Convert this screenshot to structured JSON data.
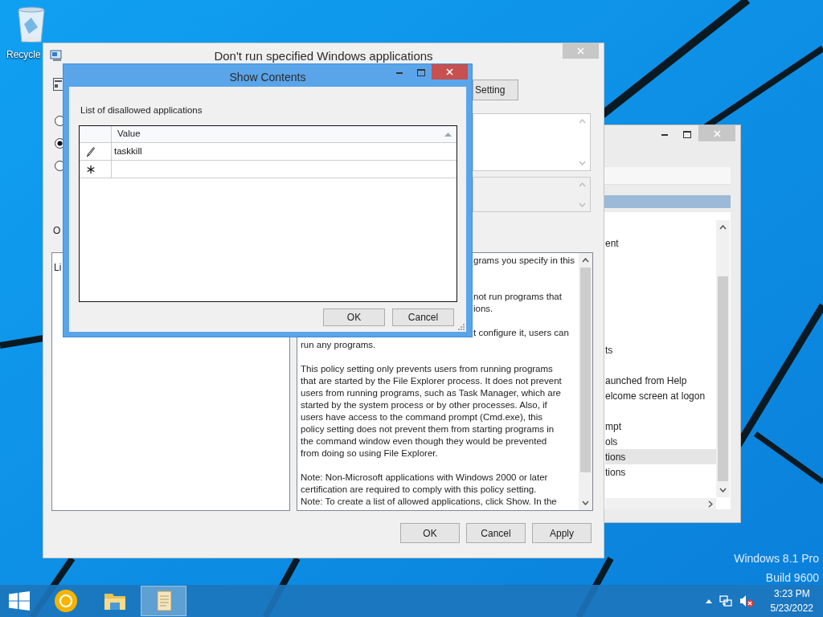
{
  "desktop": {
    "recycle_label": "Recycle",
    "edition": "Windows 8.1 Pro",
    "build": "Build 9600"
  },
  "back_window": {
    "rows": [
      {
        "kind": "covered",
        "selected": false
      },
      {
        "kind": "text",
        "text": "ent",
        "selected": false
      },
      {
        "kind": "covered",
        "selected": false
      },
      {
        "kind": "covered",
        "selected": false
      },
      {
        "kind": "covered",
        "selected": false
      },
      {
        "kind": "covered",
        "selected": false
      },
      {
        "kind": "covered",
        "selected": false
      },
      {
        "kind": "covered",
        "selected": false
      },
      {
        "kind": "text",
        "text": "ts",
        "selected": false
      },
      {
        "kind": "covered",
        "selected": false
      },
      {
        "kind": "text",
        "text": "aunched from Help",
        "selected": false
      },
      {
        "kind": "text",
        "text": "elcome screen at logon",
        "selected": false
      },
      {
        "kind": "covered",
        "selected": false
      },
      {
        "kind": "text",
        "text": "mpt",
        "selected": false
      },
      {
        "kind": "text",
        "text": "ols",
        "selected": false
      },
      {
        "kind": "text",
        "text": "tions",
        "selected": true
      },
      {
        "kind": "text",
        "text": "tions",
        "selected": false
      }
    ]
  },
  "main_window": {
    "title": "Don't run specified Windows applications",
    "setting_button": "Setting",
    "radios": [
      {
        "selected": false
      },
      {
        "selected": true
      },
      {
        "selected": false
      }
    ],
    "options_label": "O",
    "options_text": "Li",
    "help_lines": [
      {
        "kind": "partial",
        "text": "grams you specify in this"
      },
      {
        "kind": "gap"
      },
      {
        "kind": "gap"
      },
      {
        "kind": "partial",
        "text": "not run programs that"
      },
      {
        "kind": "partial",
        "text": "ions."
      },
      {
        "kind": "gap"
      },
      {
        "kind": "partial",
        "text": "t configure it, users can"
      },
      {
        "kind": "full",
        "text": "run any programs."
      },
      {
        "kind": "gap"
      },
      {
        "kind": "full",
        "text": "This policy setting only prevents users from running programs"
      },
      {
        "kind": "full",
        "text": "that are started by the File Explorer process. It does not prevent"
      },
      {
        "kind": "full",
        "text": "users from running programs, such as Task Manager, which are"
      },
      {
        "kind": "full",
        "text": "started by the system process or by other processes.  Also, if"
      },
      {
        "kind": "full",
        "text": "users have access to the command prompt (Cmd.exe), this"
      },
      {
        "kind": "full",
        "text": "policy setting does not prevent them from starting programs in"
      },
      {
        "kind": "full",
        "text": "the command window even though they would be prevented"
      },
      {
        "kind": "full",
        "text": "from doing so using File Explorer."
      },
      {
        "kind": "gap"
      },
      {
        "kind": "full",
        "text": "Note: Non-Microsoft applications with Windows 2000 or later"
      },
      {
        "kind": "full",
        "text": "certification are required to comply with this policy setting."
      },
      {
        "kind": "full",
        "text": "Note: To create a list of allowed applications, click Show.  In the"
      }
    ],
    "buttons": [
      "OK",
      "Cancel",
      "Apply"
    ]
  },
  "dialog": {
    "title": "Show Contents",
    "label": "List of disallowed applications",
    "column": "Value",
    "rows": [
      {
        "kind": "edit",
        "value": "taskkill"
      },
      {
        "kind": "new"
      }
    ],
    "buttons": [
      "OK",
      "Cancel"
    ]
  },
  "taskbar": {
    "apps": [
      {
        "kind": "browser",
        "selected": false
      },
      {
        "kind": "folder",
        "selected": false
      },
      {
        "kind": "notepad",
        "selected": true
      }
    ],
    "time": "3:23 PM",
    "date": "5/23/2022"
  }
}
